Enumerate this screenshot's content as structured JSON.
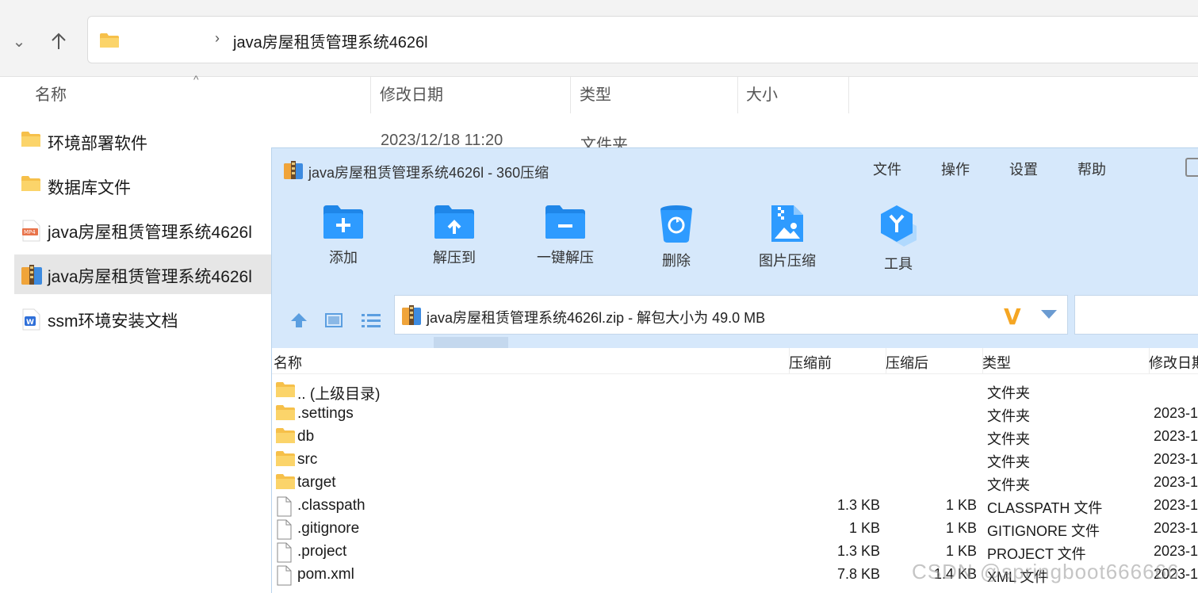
{
  "explorer": {
    "address": "java房屋租赁管理系统4626l",
    "columns": {
      "name": "名称",
      "modified": "修改日期",
      "type": "类型",
      "size": "大小"
    },
    "first_row_date": "2023/12/18 11:20",
    "first_row_type": "文件夹",
    "items": [
      {
        "name": "环境部署软件",
        "icon": "folder-icon"
      },
      {
        "name": "数据库文件",
        "icon": "folder-icon"
      },
      {
        "name": "java房屋租赁管理系统4626l",
        "icon": "mp4-file-icon"
      },
      {
        "name": "java房屋租赁管理系统4626l",
        "icon": "zip-archive-icon"
      },
      {
        "name": "ssm环境安装文档",
        "icon": "word-document-icon"
      }
    ]
  },
  "zip": {
    "title": "java房屋租赁管理系统4626l - 360压缩",
    "menu": {
      "file": "文件",
      "action": "操作",
      "settings": "设置",
      "help": "帮助"
    },
    "tools": {
      "add": "添加",
      "extract_to": "解压到",
      "one_click": "一键解压",
      "delete": "删除",
      "image_compress": "图片压缩",
      "tools": "工具"
    },
    "path": "java房屋租赁管理系统4626l.zip - 解包大小为 49.0 MB",
    "columns": {
      "name": "名称",
      "before": "压缩前",
      "after": "压缩后",
      "type": "类型",
      "modified": "修改日期"
    },
    "rows": [
      {
        "name": ".. (上级目录)",
        "before": "",
        "after": "",
        "type": "文件夹",
        "date": "",
        "icon": "folder-icon"
      },
      {
        "name": ".settings",
        "before": "",
        "after": "",
        "type": "文件夹",
        "date": "2023-1",
        "icon": "folder-icon"
      },
      {
        "name": "db",
        "before": "",
        "after": "",
        "type": "文件夹",
        "date": "2023-1",
        "icon": "folder-icon"
      },
      {
        "name": "src",
        "before": "",
        "after": "",
        "type": "文件夹",
        "date": "2023-1",
        "icon": "folder-icon"
      },
      {
        "name": "target",
        "before": "",
        "after": "",
        "type": "文件夹",
        "date": "2023-1",
        "icon": "folder-icon"
      },
      {
        "name": ".classpath",
        "before": "1.3 KB",
        "after": "1 KB",
        "type": "CLASSPATH 文件",
        "date": "2023-1",
        "icon": "file-icon"
      },
      {
        "name": ".gitignore",
        "before": "1 KB",
        "after": "1 KB",
        "type": "GITIGNORE 文件",
        "date": "2023-1",
        "icon": "file-icon"
      },
      {
        "name": ".project",
        "before": "1.3 KB",
        "after": "1 KB",
        "type": "PROJECT 文件",
        "date": "2023-1",
        "icon": "file-icon"
      },
      {
        "name": "pom.xml",
        "before": "7.8 KB",
        "after": "1.4 KB",
        "type": "XML 文件",
        "date": "2023-1",
        "icon": "file-icon"
      }
    ]
  },
  "watermark": "CSDN @springboot666666"
}
